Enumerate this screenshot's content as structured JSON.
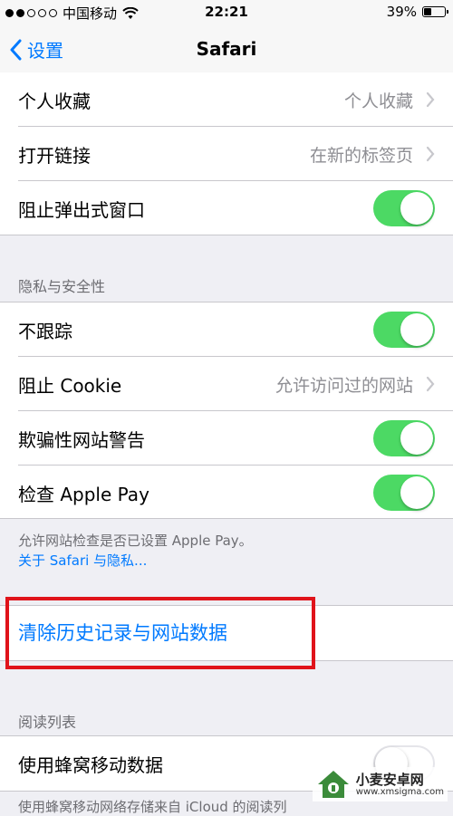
{
  "status_bar": {
    "carrier": "中国移动",
    "time": "22:21",
    "battery": "39%",
    "battery_level": 0.39
  },
  "nav": {
    "back_label": "设置",
    "title": "Safari"
  },
  "group1": {
    "rows": [
      {
        "label": "个人收藏",
        "value": "个人收藏"
      },
      {
        "label": "打开链接",
        "value": "在新的标签页"
      },
      {
        "label": "阻止弹出式窗口",
        "toggle": true
      }
    ]
  },
  "privacy": {
    "header": "隐私与安全性",
    "rows": [
      {
        "label": "不跟踪",
        "toggle": true
      },
      {
        "label": "阻止 Cookie",
        "value": "允许访问过的网站"
      },
      {
        "label": "欺骗性网站警告",
        "toggle": true
      },
      {
        "label": "检查 Apple Pay",
        "toggle": true
      }
    ],
    "footer": "允许网站检查是否已设置 Apple Pay。",
    "footer_link": "关于 Safari 与隐私..."
  },
  "clear_action": "清除历史记录与网站数据",
  "reading": {
    "header": "阅读列表",
    "rows": [
      {
        "label": "使用蜂窝移动数据",
        "toggle": false
      }
    ],
    "footer_partial": "使用蜂窝移动网络存储来自 iCloud 的阅读列"
  },
  "watermark": {
    "title": "小麦安卓网",
    "url": "www.xmsigma.com"
  },
  "colors": {
    "accent": "#007aff",
    "toggle_on": "#4cd964",
    "highlight": "#e0131a"
  }
}
